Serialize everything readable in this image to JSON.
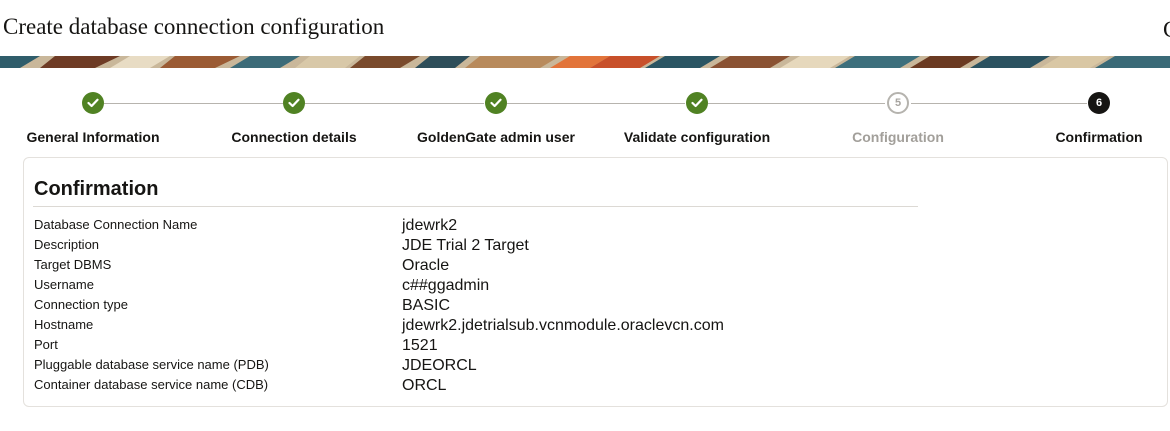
{
  "header": {
    "title": "Create database connection configuration",
    "title_overflow": "C"
  },
  "train": {
    "steps": [
      {
        "label": "General Information",
        "state": "complete",
        "number": ""
      },
      {
        "label": "Connection details",
        "state": "complete",
        "number": ""
      },
      {
        "label": "GoldenGate admin user",
        "state": "complete",
        "number": ""
      },
      {
        "label": "Validate configuration",
        "state": "complete",
        "number": ""
      },
      {
        "label": "Configuration",
        "state": "not-visited",
        "number": "5"
      },
      {
        "label": "Confirmation",
        "state": "current",
        "number": "6"
      }
    ],
    "complete_color": "#508223",
    "current_color": "#161513"
  },
  "confirmation": {
    "title": "Confirmation",
    "rows": [
      {
        "label": "Database Connection Name",
        "value": "jdewrk2"
      },
      {
        "label": "Description",
        "value": "JDE Trial 2 Target"
      },
      {
        "label": "Target DBMS",
        "value": "Oracle"
      },
      {
        "label": "Username",
        "value": "c##ggadmin"
      },
      {
        "label": "Connection type",
        "value": "BASIC"
      },
      {
        "label": "Hostname",
        "value": "jdewrk2.jdetrialsub.vcnmodule.oraclevcn.com"
      },
      {
        "label": "Port",
        "value": "1521"
      },
      {
        "label": "Pluggable database service name (PDB)",
        "value": "JDEORCL"
      },
      {
        "label": "Container database service name (CDB)",
        "value": "ORCL"
      }
    ]
  }
}
